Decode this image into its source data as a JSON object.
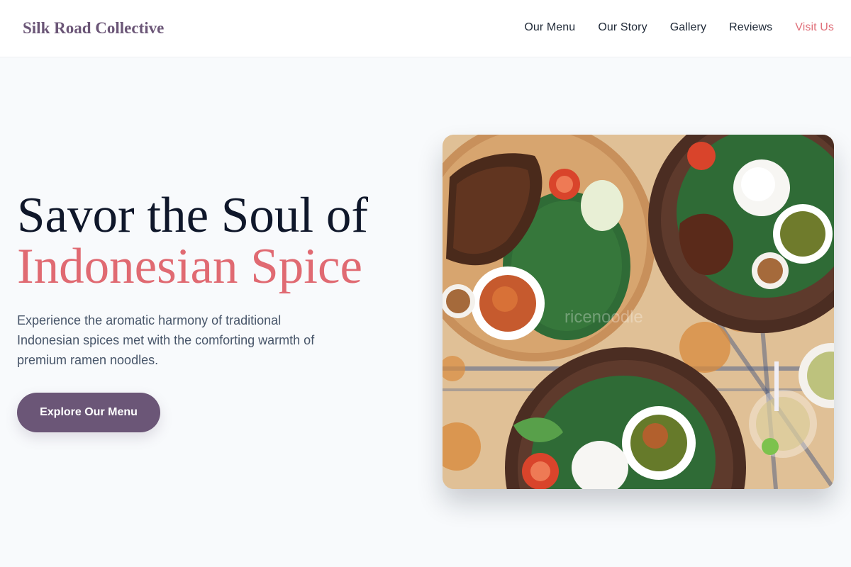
{
  "header": {
    "brand": "Silk Road Collective",
    "nav": [
      "Our Menu",
      "Our Story",
      "Gallery",
      "Reviews",
      "Visit Us"
    ]
  },
  "hero": {
    "title_line1": "Savor the Soul of",
    "title_line2": "Indonesian Spice",
    "description": "Experience the aromatic harmony of traditional Indonesian spices met with the comforting warmth of premium ramen noodles.",
    "cta_label": "Explore Our Menu",
    "image_watermark": "ricenoodle"
  },
  "colors": {
    "brand": "#6b5677",
    "accent": "#e06a72",
    "text_dark": "#0f172a",
    "text_muted": "#475569",
    "background": "#f8fafc"
  }
}
